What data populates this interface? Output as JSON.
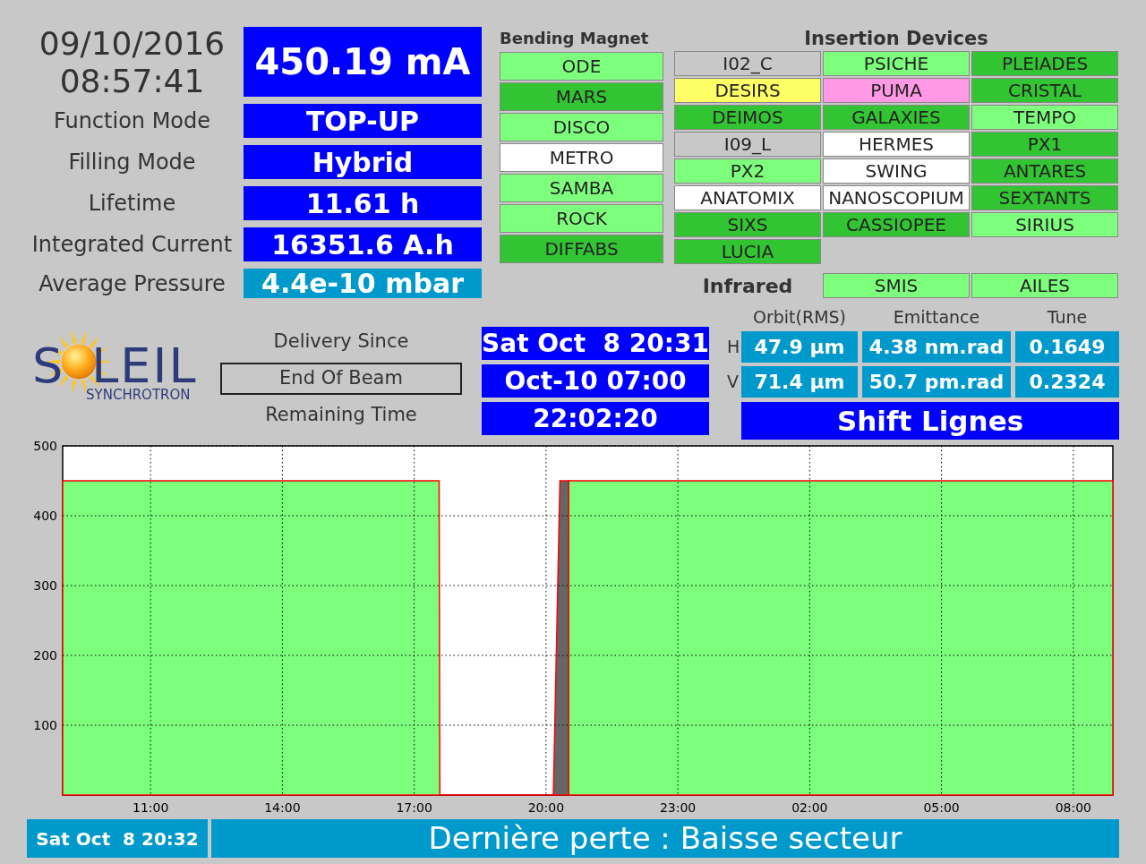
{
  "clock": {
    "date": "09/10/2016",
    "time": "08:57:41"
  },
  "beam_current": "450.19 mA",
  "parameters": [
    {
      "label": "Function Mode",
      "value": "TOP-UP",
      "kind": "primary"
    },
    {
      "label": "Filling Mode",
      "value": "Hybrid",
      "kind": "primary"
    },
    {
      "label": "Lifetime",
      "value": "11.61 h",
      "kind": "primary"
    },
    {
      "label": "Integrated Current",
      "value": "16351.6 A.h",
      "kind": "primary"
    },
    {
      "label": "Average Pressure",
      "value": "4.4e-10 mbar",
      "kind": "secondary"
    }
  ],
  "bending_magnet": {
    "title": "Bending Magnet",
    "beamlines": [
      {
        "name": "ODE",
        "color": "#7dff7d"
      },
      {
        "name": "MARS",
        "color": "#33c433"
      },
      {
        "name": "DISCO",
        "color": "#7dff7d"
      },
      {
        "name": "METRO",
        "color": "#ffffff"
      },
      {
        "name": "SAMBA",
        "color": "#7dff7d"
      },
      {
        "name": "ROCK",
        "color": "#7dff7d"
      },
      {
        "name": "DIFFABS",
        "color": "#33c433"
      }
    ]
  },
  "insertion_devices": {
    "title": "Insertion Devices",
    "beamlines": [
      {
        "name": "I02_C",
        "color": "#c8c8c8"
      },
      {
        "name": "PSICHE",
        "color": "#7dff7d"
      },
      {
        "name": "PLEIADES",
        "color": "#33c433"
      },
      {
        "name": "DESIRS",
        "color": "#ffff66"
      },
      {
        "name": "PUMA",
        "color": "#ff99e6"
      },
      {
        "name": "CRISTAL",
        "color": "#33c433"
      },
      {
        "name": "DEIMOS",
        "color": "#33c433"
      },
      {
        "name": "GALAXIES",
        "color": "#33c433"
      },
      {
        "name": "TEMPO",
        "color": "#7dff7d"
      },
      {
        "name": "I09_L",
        "color": "#c8c8c8"
      },
      {
        "name": "HERMES",
        "color": "#ffffff"
      },
      {
        "name": "PX1",
        "color": "#33c433"
      },
      {
        "name": "PX2",
        "color": "#7dff7d"
      },
      {
        "name": "SWING",
        "color": "#ffffff"
      },
      {
        "name": "ANTARES",
        "color": "#33c433"
      },
      {
        "name": "ANATOMIX",
        "color": "#ffffff"
      },
      {
        "name": "NANOSCOPIUM",
        "color": "#ffffff"
      },
      {
        "name": "SEXTANTS",
        "color": "#33c433"
      },
      {
        "name": "SIXS",
        "color": "#33c433"
      },
      {
        "name": "CASSIOPEE",
        "color": "#33c433"
      },
      {
        "name": "SIRIUS",
        "color": "#7dff7d"
      },
      {
        "name": "LUCIA",
        "color": "#33c433"
      }
    ]
  },
  "infrared": {
    "title": "Infrared",
    "beamlines": [
      {
        "name": "SMIS",
        "color": "#7dff7d"
      },
      {
        "name": "AILES",
        "color": "#7dff7d"
      }
    ]
  },
  "logo": {
    "start": "S",
    "end": "LEIL",
    "subtitle": "SYNCHROTRON"
  },
  "delivery": [
    {
      "label": "Delivery Since",
      "value": "Sat Oct  8 20:31",
      "kind": "plain"
    },
    {
      "label": "End Of Beam",
      "value": "Oct-10 07:00",
      "kind": "boxed"
    },
    {
      "label": "Remaining Time",
      "value": "22:02:20",
      "kind": "plain"
    }
  ],
  "beam_stats": {
    "columns": [
      "Orbit(RMS)",
      "Emittance",
      "Tune"
    ],
    "rows": [
      {
        "plane": "H",
        "values": [
          "47.9 µm",
          "4.38 nm.rad",
          "0.1649"
        ]
      },
      {
        "plane": "V",
        "values": [
          "71.4 µm",
          "50.7 pm.rad",
          "0.2324"
        ]
      }
    ]
  },
  "shift": "Shift Lignes",
  "chart": {
    "chart_data": {
      "type": "area",
      "x": [
        "2016-10-08 09:00",
        "2016-10-08 17:34",
        "2016-10-08 17:35",
        "2016-10-08 20:10",
        "2016-10-08 20:15",
        "2016-10-08 20:19",
        "2016-10-08 20:31",
        "2016-10-09 08:54"
      ],
      "series": [
        {
          "color": "#7dff7d",
          "values": [
            450,
            450,
            0,
            0,
            null,
            null,
            450,
            450
          ]
        },
        {
          "color": "#666666",
          "values": [
            null,
            null,
            null,
            0,
            250,
            450,
            450,
            null
          ]
        }
      ],
      "xlim": [
        "2016-10-08 09:00",
        "2016-10-09 08:54"
      ],
      "ylim": [
        0,
        500
      ],
      "xticks": [
        {
          "value": "2016-10-08 11:00",
          "label": "11:00"
        },
        {
          "value": "2016-10-08 14:00",
          "label": "14:00"
        },
        {
          "value": "2016-10-08 17:00",
          "label": "17:00"
        },
        {
          "value": "2016-10-08 20:00",
          "label": "20:00"
        },
        {
          "value": "2016-10-08 23:00",
          "label": "23:00"
        },
        {
          "value": "2016-10-09 02:00",
          "label": "02:00"
        },
        {
          "value": "2016-10-09 05:00",
          "label": "05:00"
        },
        {
          "value": "2016-10-09 08:00",
          "label": "08:00"
        }
      ],
      "yticks": [
        100,
        200,
        300,
        400,
        500
      ],
      "grid": true
    }
  },
  "status_bar": {
    "time": "Sat Oct  8 20:32",
    "message": "Dernière perte : Baisse secteur"
  }
}
